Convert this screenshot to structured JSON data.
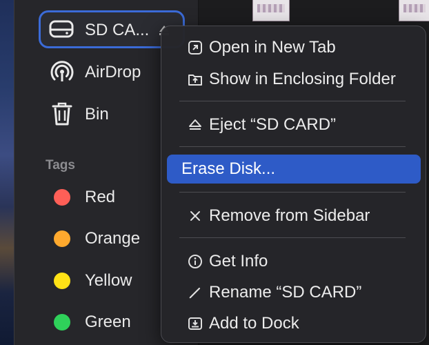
{
  "sidebar": {
    "locations": [
      {
        "id": "sd-card",
        "label": "SD CA...",
        "icon": "drive-icon"
      },
      {
        "id": "airdrop",
        "label": "AirDrop",
        "icon": "airdrop-icon"
      },
      {
        "id": "bin",
        "label": "Bin",
        "icon": "trash-icon"
      }
    ],
    "tags_heading": "Tags",
    "tags": [
      {
        "label": "Red",
        "color": "#ff5f57"
      },
      {
        "label": "Orange",
        "color": "#ffa92e"
      },
      {
        "label": "Yellow",
        "color": "#ffe216"
      },
      {
        "label": "Green",
        "color": "#2fd15a"
      }
    ]
  },
  "context_menu": {
    "items": [
      {
        "label": "Open in New Tab",
        "icon": "new-tab-icon"
      },
      {
        "label": "Show in Enclosing Folder",
        "icon": "enclosing-folder-icon"
      },
      {
        "label": "Eject “SD CARD”",
        "icon": "eject-icon"
      },
      {
        "label": "Erase Disk...",
        "highlighted": true
      },
      {
        "label": "Remove from Sidebar",
        "icon": "remove-x-icon"
      },
      {
        "label": "Get Info",
        "icon": "info-icon"
      },
      {
        "label": "Rename “SD CARD”",
        "icon": "pencil-icon"
      },
      {
        "label": "Add to Dock",
        "icon": "add-to-dock-icon"
      }
    ]
  },
  "colors": {
    "selection_outline": "#3b6bd8",
    "menu_highlight": "#2e5bc7"
  }
}
